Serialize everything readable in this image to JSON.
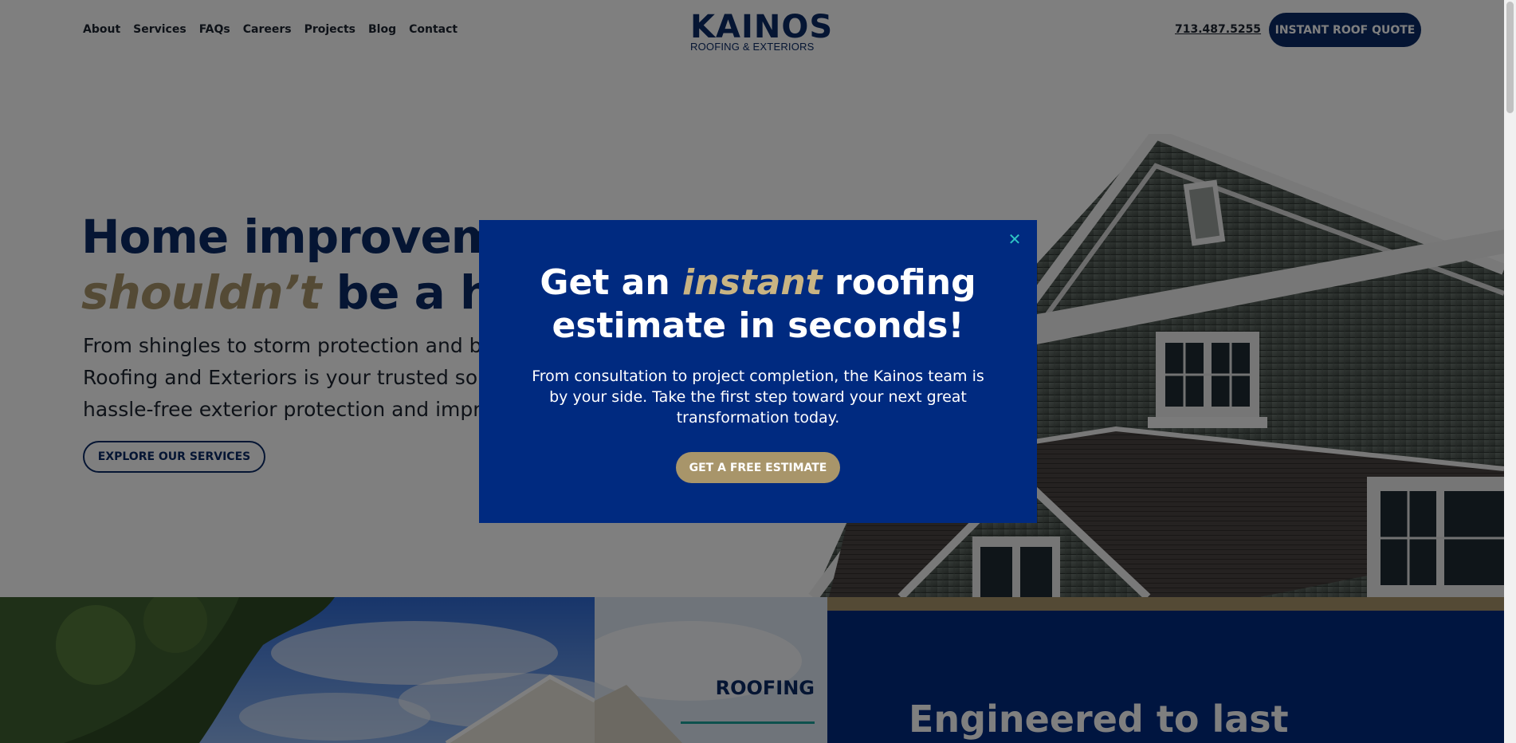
{
  "header": {
    "nav": [
      "About",
      "Services",
      "FAQs",
      "Careers",
      "Projects",
      "Blog",
      "Contact"
    ],
    "logo_wordmark": "KAINOS",
    "logo_tagline": "ROOFING & EXTERIORS",
    "phone": "713.487.5255",
    "quote_button": "INSTANT ROOF QUOTE"
  },
  "hero": {
    "title_line1": "Home improvement",
    "title_accent": "shouldn’t",
    "title_line2_rest": " be a headache",
    "description": "From shingles to storm protection and beyond, Kainos Roofing and Exteriors is your trusted source for hassle-free exterior protection and improvements.",
    "explore_button": "EXPLORE OUR SERVICES"
  },
  "lower": {
    "roofing_label": "ROOFING",
    "engineered_title": "Engineered to last"
  },
  "modal": {
    "title_pre": "Get an ",
    "title_accent": "instant",
    "title_post": " roofing estimate in seconds!",
    "text": "From consultation to project completion, the Kainos team is by your side. Take the first step toward your next great transformation today.",
    "cta": "GET A FREE ESTIMATE",
    "close_icon": "close-icon"
  },
  "colors": {
    "navy": "#0b2a66",
    "modal_blue": "#002a80",
    "gold": "#a8956a",
    "teal": "#1aa39a"
  }
}
